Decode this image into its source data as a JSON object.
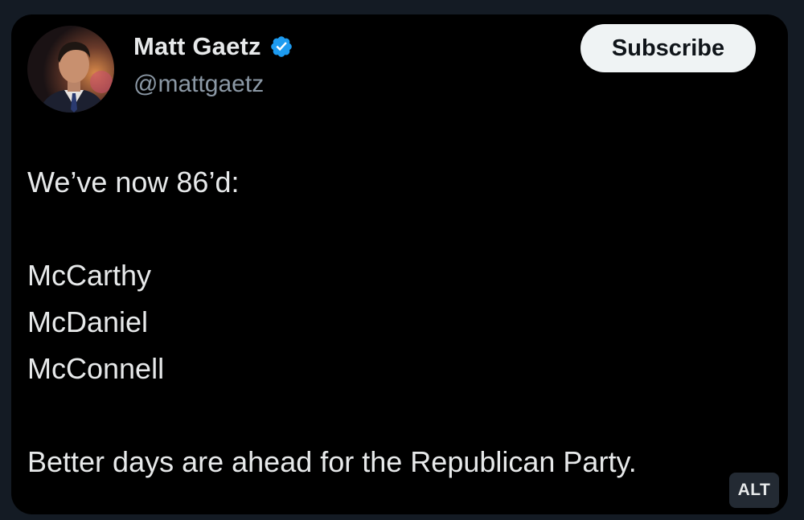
{
  "post": {
    "author": {
      "display_name": "Matt Gaetz",
      "handle": "@mattgaetz",
      "verified_icon": "verified-badge-icon"
    },
    "subscribe_label": "Subscribe",
    "lines": {
      "intro": "We’ve now 86’d:",
      "name_1": "McCarthy",
      "name_2": "McDaniel",
      "name_3": "McConnell",
      "closing": "Better days are ahead for the Republican Party."
    },
    "alt_label": "ALT"
  },
  "colors": {
    "page_background": "#141b24",
    "card_background": "#000000",
    "text_primary": "#e7e9ea",
    "text_secondary": "#8b98a5",
    "verified_blue": "#1d9bf0",
    "subscribe_background": "#eff3f4"
  }
}
